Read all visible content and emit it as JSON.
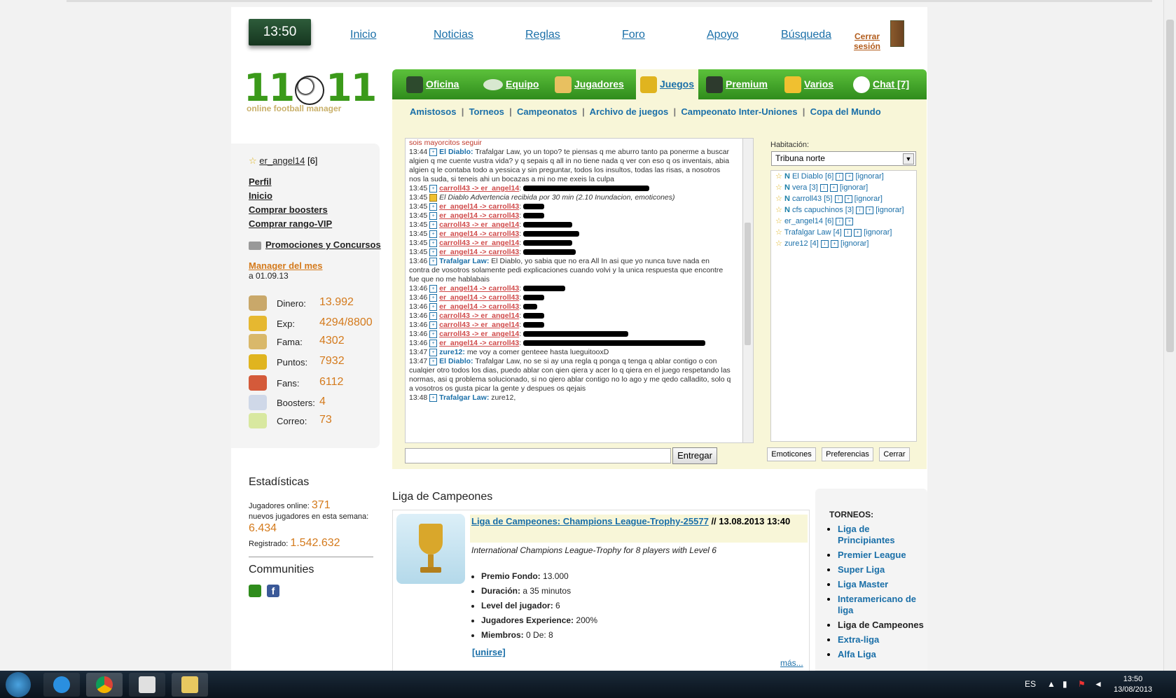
{
  "clock": "13:50",
  "top_nav": [
    "Inicio",
    "Noticias",
    "Reglas",
    "Foro",
    "Apoyo",
    "Búsqueda"
  ],
  "logout": "Cerrar sesión",
  "logo": {
    "left": "11",
    "right": "11",
    "sub": "online football manager"
  },
  "main_nav": [
    {
      "label": "Oficina",
      "icon": "manager-icon"
    },
    {
      "label": "Equipo",
      "icon": "stadium-icon"
    },
    {
      "label": "Jugadores",
      "icon": "players-icon"
    },
    {
      "label": "Juegos",
      "icon": "trophy-ball-icon",
      "active": true
    },
    {
      "label": "Premium",
      "icon": "premium-icon"
    },
    {
      "label": "Varios",
      "icon": "beer-icon"
    },
    {
      "label": "Chat [7]",
      "icon": "chat-bubble-icon"
    }
  ],
  "sub_nav": [
    "Amistosos",
    "Torneos",
    "Campeonatos",
    "Archivo de juegos",
    "Campeonato Inter-Uniones",
    "Copa del Mundo"
  ],
  "sidebar": {
    "username": "er_angel14",
    "level": "[6]",
    "links": [
      "Perfil",
      "Inicio",
      "Comprar boosters",
      "Comprar rango-VIP"
    ],
    "promo": "Promociones y Concursos",
    "motm_label": "Manager del mes",
    "motm_date": "a 01.09.13",
    "stats": [
      {
        "label": "Dinero:",
        "value": "13.992",
        "icon": "money-bag-icon",
        "color": "#c9a86a"
      },
      {
        "label": "Exp:",
        "value": "4294/8800",
        "icon": "exp-icon",
        "color": "#e6b830"
      },
      {
        "label": "Fama:",
        "value": "4302",
        "icon": "podium-icon",
        "color": "#d9b86a"
      },
      {
        "label": "Puntos:",
        "value": "7932",
        "icon": "trophy-icon",
        "color": "#e0b41f"
      },
      {
        "label": "Fans:",
        "value": "6112",
        "icon": "fans-icon",
        "color": "#d45a3a"
      },
      {
        "label": "Boosters:",
        "value": "4",
        "icon": "booster-icon",
        "color": "#cfd8e8"
      },
      {
        "label": "Correo:",
        "value": "73",
        "icon": "mail-icon",
        "color": "#d8e8a0"
      }
    ]
  },
  "stats_section": {
    "title": "Estadísticas",
    "online_label": "Jugadores online:",
    "online_value": "371",
    "new_label": "nuevos jugadores en esta semana:",
    "new_value": "6.434",
    "registered_label": "Registrado:",
    "registered_value": "1.542.632"
  },
  "communities_title": "Communities",
  "chat": {
    "messages": [
      {
        "time": "",
        "user": "",
        "text": "sois mayorcitos seguir",
        "style": "red"
      },
      {
        "time": "13:44",
        "user": "El Diablo:",
        "text": "Trafalgar Law, yo un topo? te piensas q me aburro tanto pa ponerme a buscar algien q me cuente vustra vida? y q sepais q all in no tiene nada q ver con eso q os inventais, abia algien q le contaba todo a yessica y sin preguntar, todos los insultos, todas las risas, a nosotros nos la suda, si teneis ahi un bocazas a mi no me exeis la culpa",
        "style": "wrap"
      },
      {
        "time": "13:45",
        "user": "carroll43 -> er_angel14",
        "text": "",
        "style": "pm",
        "redact": 180
      },
      {
        "time": "13:45",
        "user": "",
        "text": "El Diablo Advertencia recibida por 30 min (2.10 Inundacion, emoticones)",
        "style": "warn"
      },
      {
        "time": "13:45",
        "user": "er_angel14 -> carroll43",
        "text": "",
        "style": "pm",
        "redact": 30
      },
      {
        "time": "13:45",
        "user": "er_angel14 -> carroll43",
        "text": "",
        "style": "pm",
        "redact": 30
      },
      {
        "time": "13:45",
        "user": "carroll43 -> er_angel14",
        "text": "",
        "style": "pm",
        "redact": 70
      },
      {
        "time": "13:45",
        "user": "er_angel14 -> carroll43",
        "text": "",
        "style": "pm",
        "redact": 80
      },
      {
        "time": "13:45",
        "user": "carroll43 -> er_angel14",
        "text": "",
        "style": "pm",
        "redact": 70
      },
      {
        "time": "13:45",
        "user": "er_angel14 -> carroll43",
        "text": "",
        "style": "pm",
        "redact": 75
      },
      {
        "time": "13:46",
        "user": "Trafalgar Law:",
        "text": "El Diablo, yo sabia que no era All In asi que yo nunca tuve nada en contra de vosotros solamente pedi explicaciones cuando volvi y la unica respuesta que encontre fue que no me hablabais",
        "style": "wrap"
      },
      {
        "time": "13:46",
        "user": "er_angel14 -> carroll43",
        "text": "",
        "style": "pm",
        "redact": 60
      },
      {
        "time": "13:46",
        "user": "er_angel14 -> carroll43",
        "text": "",
        "style": "pm",
        "redact": 30
      },
      {
        "time": "13:46",
        "user": "er_angel14 -> carroll43",
        "text": "",
        "style": "pm",
        "redact": 20
      },
      {
        "time": "13:46",
        "user": "carroll43 -> er_angel14",
        "text": "",
        "style": "pm",
        "redact": 30
      },
      {
        "time": "13:46",
        "user": "carroll43 -> er_angel14",
        "text": "",
        "style": "pm",
        "redact": 30
      },
      {
        "time": "13:46",
        "user": "carroll43 -> er_angel14",
        "text": "",
        "style": "pm",
        "redact": 150
      },
      {
        "time": "13:46",
        "user": "er_angel14 -> carroll43",
        "text": "",
        "style": "pm",
        "redact": 260
      },
      {
        "time": "13:47",
        "user": "zure12:",
        "text": "me voy a comer genteee hasta lueguitooxD",
        "style": "normal"
      },
      {
        "time": "13:47",
        "user": "El Diablo:",
        "text": "Trafalgar Law, no se si ay una regla q ponga q tenga q ablar contigo o con cualqier otro todos los dias, puedo ablar con qien qiera y acer lo q qiera en el juego respetando las normas, asi q problema solucionado, si no qiero ablar contigo no lo ago y me qedo calladito, solo q a vosotros os gusta picar la gente y despues os qejais",
        "style": "wrap"
      },
      {
        "time": "13:48",
        "user": "Trafalgar Law:",
        "text": "zure12,",
        "style": "normal"
      }
    ],
    "input_value": "",
    "send_label": "Entregar",
    "room_label": "Habitación:",
    "room_value": "Tribuna norte",
    "users": [
      {
        "name": "El Diablo [6]",
        "ignore": "[ignorar]"
      },
      {
        "name": "vera [3]",
        "ignore": "[ignorar]"
      },
      {
        "name": "carroll43 [5]",
        "ignore": "[ignorar]"
      },
      {
        "name": "cfs capuchinos [3]",
        "ignore": "[ignorar]"
      },
      {
        "name": "er_angel14 [6]",
        "ignore": ""
      },
      {
        "name": "Trafalgar Law [4]",
        "ignore": "[ignorar]"
      },
      {
        "name": "zure12 [4]",
        "ignore": "[ignorar]"
      }
    ],
    "buttons": [
      "Emoticones",
      "Preferencias",
      "Cerrar"
    ]
  },
  "liga": {
    "section_title": "Liga de Campeones",
    "title_link": "Liga de Campeones: Champions League-Trophy-25577",
    "title_date": "// 13.08.2013 13:40",
    "description": "International Champions League-Trophy for 8 players with Level 6",
    "details": [
      {
        "label": "Premio Fondo:",
        "value": "13.000"
      },
      {
        "label": "Duración:",
        "value": "a 35 minutos"
      },
      {
        "label": "Level del jugador:",
        "value": "6"
      },
      {
        "label": "Jugadores Experience:",
        "value": "200%"
      },
      {
        "label": "Miembros:",
        "value": "0 De: 8"
      }
    ],
    "join": "[unirse]",
    "more": "más..."
  },
  "torneos": {
    "title": "TORNEOS:",
    "items": [
      {
        "label": "Liga de Principiantes",
        "link": true
      },
      {
        "label": "Premier League",
        "link": true
      },
      {
        "label": "Super Liga",
        "link": true
      },
      {
        "label": "Liga Master",
        "link": true
      },
      {
        "label": "Interamericano de liga",
        "link": true
      },
      {
        "label": "Liga de Campeones",
        "link": false
      },
      {
        "label": "Extra-liga",
        "link": true
      },
      {
        "label": "Alfa Liga",
        "link": true
      }
    ]
  },
  "taskbar": {
    "lang": "ES",
    "time": "13:50",
    "date": "13/08/2013"
  }
}
